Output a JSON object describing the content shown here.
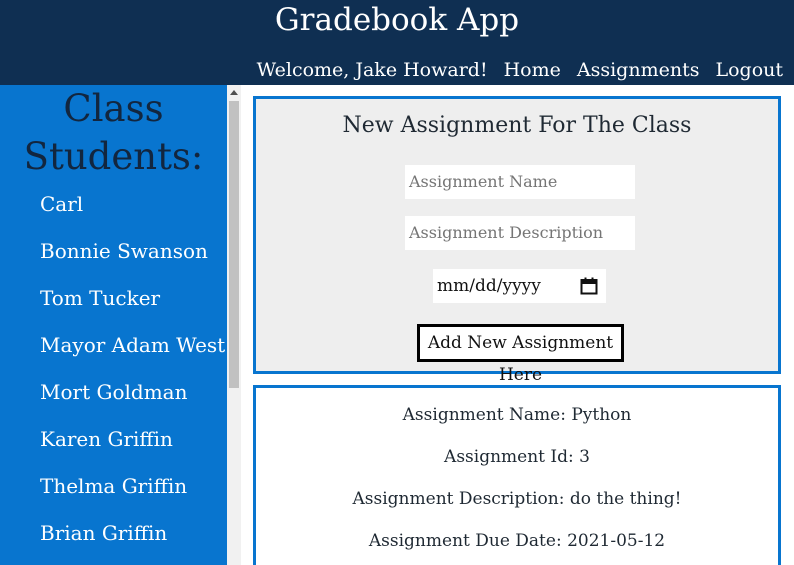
{
  "header": {
    "title": "Gradebook App",
    "welcome": "Welcome, Jake Howard!",
    "nav": [
      "Home",
      "Assignments",
      "Logout"
    ]
  },
  "sidebar": {
    "title_line1": "Class",
    "title_line2": "Students:",
    "students": [
      "Carl",
      "Bonnie Swanson",
      "Tom Tucker",
      "Mayor Adam West",
      "Mort Goldman",
      "Karen Griffin",
      "Thelma Griffin",
      "Brian Griffin"
    ]
  },
  "form": {
    "title": "New Assignment For The Class",
    "name_placeholder": "Assignment Name",
    "description_placeholder": "Assignment Description",
    "date_placeholder": "mm/dd/yyyy",
    "submit_label": "Add New Assignment Here"
  },
  "assignment": {
    "name_line": "Assignment Name: Python",
    "id_line": "Assignment Id: 3",
    "description_line": "Assignment Description: do the thing!",
    "due_line": "Assignment Due Date: 2021-05-12"
  },
  "colors": {
    "header_bg": "#0f2f52",
    "sidebar_bg": "#0875cf",
    "card_border": "#0875cf",
    "form_bg": "#eeeeee"
  },
  "icons": [
    "calendar-icon",
    "scroll-up-arrow-icon"
  ]
}
